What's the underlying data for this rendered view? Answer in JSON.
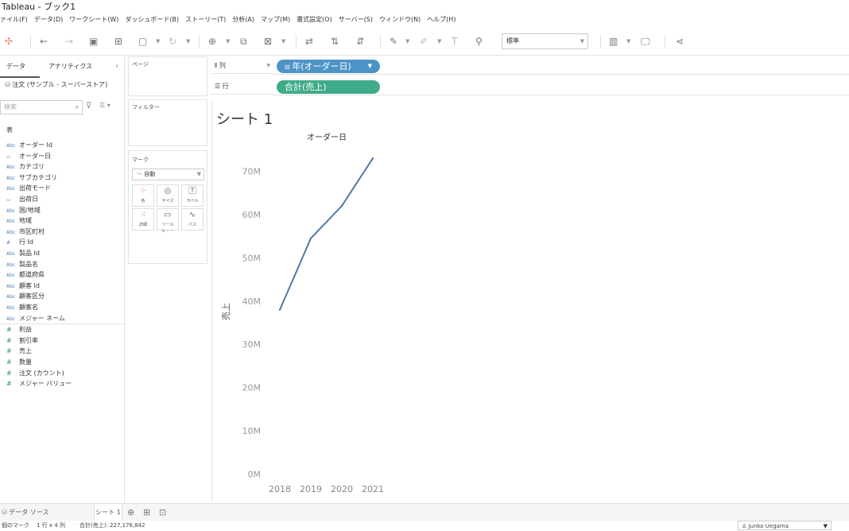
{
  "app": {
    "title": "Tableau - ブック1"
  },
  "menu": [
    "ァイル(F)",
    "データ(D)",
    "ワークシート(W)",
    "ダッシュボード(B)",
    "ストーリー(T)",
    "分析(A)",
    "マップ(M)",
    "書式設定(O)",
    "サーバー(S)",
    "ウィンドウ(N)",
    "ヘルプ(H)"
  ],
  "toolbar": {
    "format_value": "標準"
  },
  "left_pane": {
    "tab_data": "データ",
    "tab_analytics": "アナリティクス",
    "datasource": "注文 (サンプル - スーパーストア)",
    "search_placeholder": "検索",
    "tables_heading": "表",
    "dimensions": [
      {
        "type": "Abc",
        "name": "オーダー Id"
      },
      {
        "type": "date",
        "name": "オーダー日"
      },
      {
        "type": "Abc",
        "name": "カテゴリ"
      },
      {
        "type": "Abc",
        "name": "サブカテゴリ"
      },
      {
        "type": "Abc",
        "name": "出荷モード"
      },
      {
        "type": "date",
        "name": "出荷日"
      },
      {
        "type": "Abc",
        "name": "国/地域"
      },
      {
        "type": "Abc",
        "name": "地域"
      },
      {
        "type": "Abc",
        "name": "市区町村"
      },
      {
        "type": "#",
        "name": "行 Id"
      },
      {
        "type": "Abc",
        "name": "製品 Id"
      },
      {
        "type": "Abc",
        "name": "製品名"
      },
      {
        "type": "Abc",
        "name": "都道府県"
      },
      {
        "type": "Abc",
        "name": "顧客 Id"
      },
      {
        "type": "Abc",
        "name": "顧客区分"
      },
      {
        "type": "Abc",
        "name": "顧客名"
      },
      {
        "type": "Abc",
        "name": "メジャー ネーム"
      }
    ],
    "measures": [
      {
        "type": "#",
        "name": "利益"
      },
      {
        "type": "#",
        "name": "割引率"
      },
      {
        "type": "#",
        "name": "売上"
      },
      {
        "type": "#",
        "name": "数量"
      },
      {
        "type": "#",
        "name": "注文 (カウント)"
      },
      {
        "type": "#",
        "name": "メジャー バリュー"
      }
    ]
  },
  "cards": {
    "pages": "ページ",
    "filters": "フィルター",
    "marks": "マーク",
    "mark_type": "自動",
    "mark_buttons": [
      "色",
      "サイズ",
      "ラベル",
      "詳細",
      "ツールヒ・・",
      "パス"
    ]
  },
  "shelves": {
    "columns_label": "列",
    "rows_label": "行",
    "columns_pill": "年(オーダー日)",
    "rows_pill": "合計(売上)"
  },
  "sheet": {
    "title": "シート 1"
  },
  "chart_data": {
    "type": "line",
    "title": "オーダー日",
    "ylabel": "売上",
    "xlabel": "",
    "categories": [
      "2018",
      "2019",
      "2020",
      "2021"
    ],
    "values": [
      38,
      54.5,
      62,
      73
    ],
    "ylim": [
      0,
      75
    ],
    "yticks": [
      "0M",
      "10M",
      "20M",
      "30M",
      "40M",
      "50M",
      "60M",
      "70M"
    ],
    "line_color": "#4e79a7",
    "grid": false
  },
  "bottom": {
    "datasource_tab": "データ ソース",
    "sheet_tab": "シート 1"
  },
  "status": {
    "marks": "個のマーク",
    "dims": "1 行 x 4 列",
    "sum": "合計(売上): 227,176,842",
    "user": "Junko Uegama"
  }
}
